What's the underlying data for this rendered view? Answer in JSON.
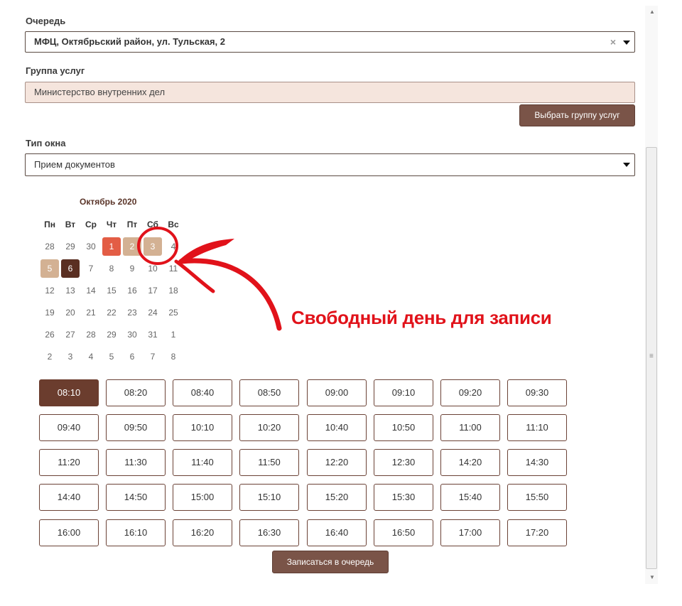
{
  "form": {
    "queue": {
      "label": "Очередь",
      "value": "МФЦ, Октябрьский район, ул. Тульская, 2",
      "clear": "×"
    },
    "service_group": {
      "label": "Группа услуг",
      "value": "Министерство внутренних дел",
      "button": "Выбрать группу услуг"
    },
    "window_type": {
      "label": "Тип окна",
      "value": "Прием документов"
    }
  },
  "calendar": {
    "title": "Октябрь 2020",
    "weekdays": [
      "Пн",
      "Вт",
      "Ср",
      "Чт",
      "Пт",
      "Сб",
      "Вс"
    ],
    "weeks": [
      [
        "28",
        "29",
        "30",
        "1",
        "2",
        "3",
        "4"
      ],
      [
        "5",
        "6",
        "7",
        "8",
        "9",
        "10",
        "11"
      ],
      [
        "12",
        "13",
        "14",
        "15",
        "16",
        "17",
        "18"
      ],
      [
        "19",
        "20",
        "21",
        "22",
        "23",
        "24",
        "25"
      ],
      [
        "26",
        "27",
        "28",
        "29",
        "30",
        "31",
        "1"
      ],
      [
        "2",
        "3",
        "4",
        "5",
        "6",
        "7",
        "8"
      ]
    ],
    "states": {
      "0-3": "today",
      "0-4": "free",
      "0-5": "free",
      "1-0": "free",
      "1-1": "selected"
    }
  },
  "slots": [
    "08:10",
    "08:20",
    "08:40",
    "08:50",
    "09:00",
    "09:10",
    "09:20",
    "09:30",
    "09:40",
    "09:50",
    "10:10",
    "10:20",
    "10:40",
    "10:50",
    "11:00",
    "11:10",
    "11:20",
    "11:30",
    "11:40",
    "11:50",
    "12:20",
    "12:30",
    "14:20",
    "14:30",
    "14:40",
    "14:50",
    "15:00",
    "15:10",
    "15:20",
    "15:30",
    "15:40",
    "15:50",
    "16:00",
    "16:10",
    "16:20",
    "16:30",
    "16:40",
    "16:50",
    "17:00",
    "17:20"
  ],
  "active_slot": "08:10",
  "submit_label": "Записаться в очередь",
  "annotation": {
    "text": "Свободный день для записи",
    "color": "#e1121a"
  },
  "colors": {
    "accent": "#6b3d2e",
    "today": "#e35d45",
    "free": "#d3b193",
    "selected": "#5a2f22"
  },
  "scrollbar": {
    "up_icon": "▲",
    "down_icon": "▼",
    "grip_icon": "≡"
  }
}
